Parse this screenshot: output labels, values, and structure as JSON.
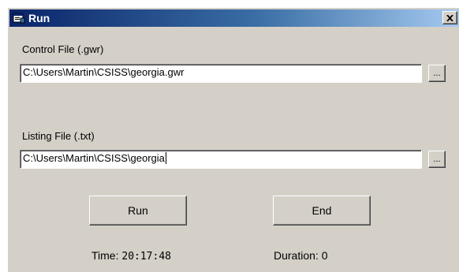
{
  "window": {
    "title": "Run",
    "title_icon": "run-app-icon",
    "close_icon": "close-icon"
  },
  "control_file": {
    "label": "Control File (.gwr)",
    "value": "C:\\Users\\Martin\\CSISS\\georgia.gwr",
    "browse_label": "..."
  },
  "listing_file": {
    "label": "Listing File (.txt)",
    "value": "C:\\Users\\Martin\\CSISS\\georgia",
    "browse_label": "..."
  },
  "buttons": {
    "run_label": "Run",
    "end_label": "End"
  },
  "status": {
    "time_label": "Time:",
    "time_value": "20:17:48",
    "duration_label": "Duration:",
    "duration_value": "0"
  },
  "colors": {
    "titlebar_start": "#0a246a",
    "titlebar_end": "#a6caf0",
    "window_face": "#d4d0c8"
  }
}
